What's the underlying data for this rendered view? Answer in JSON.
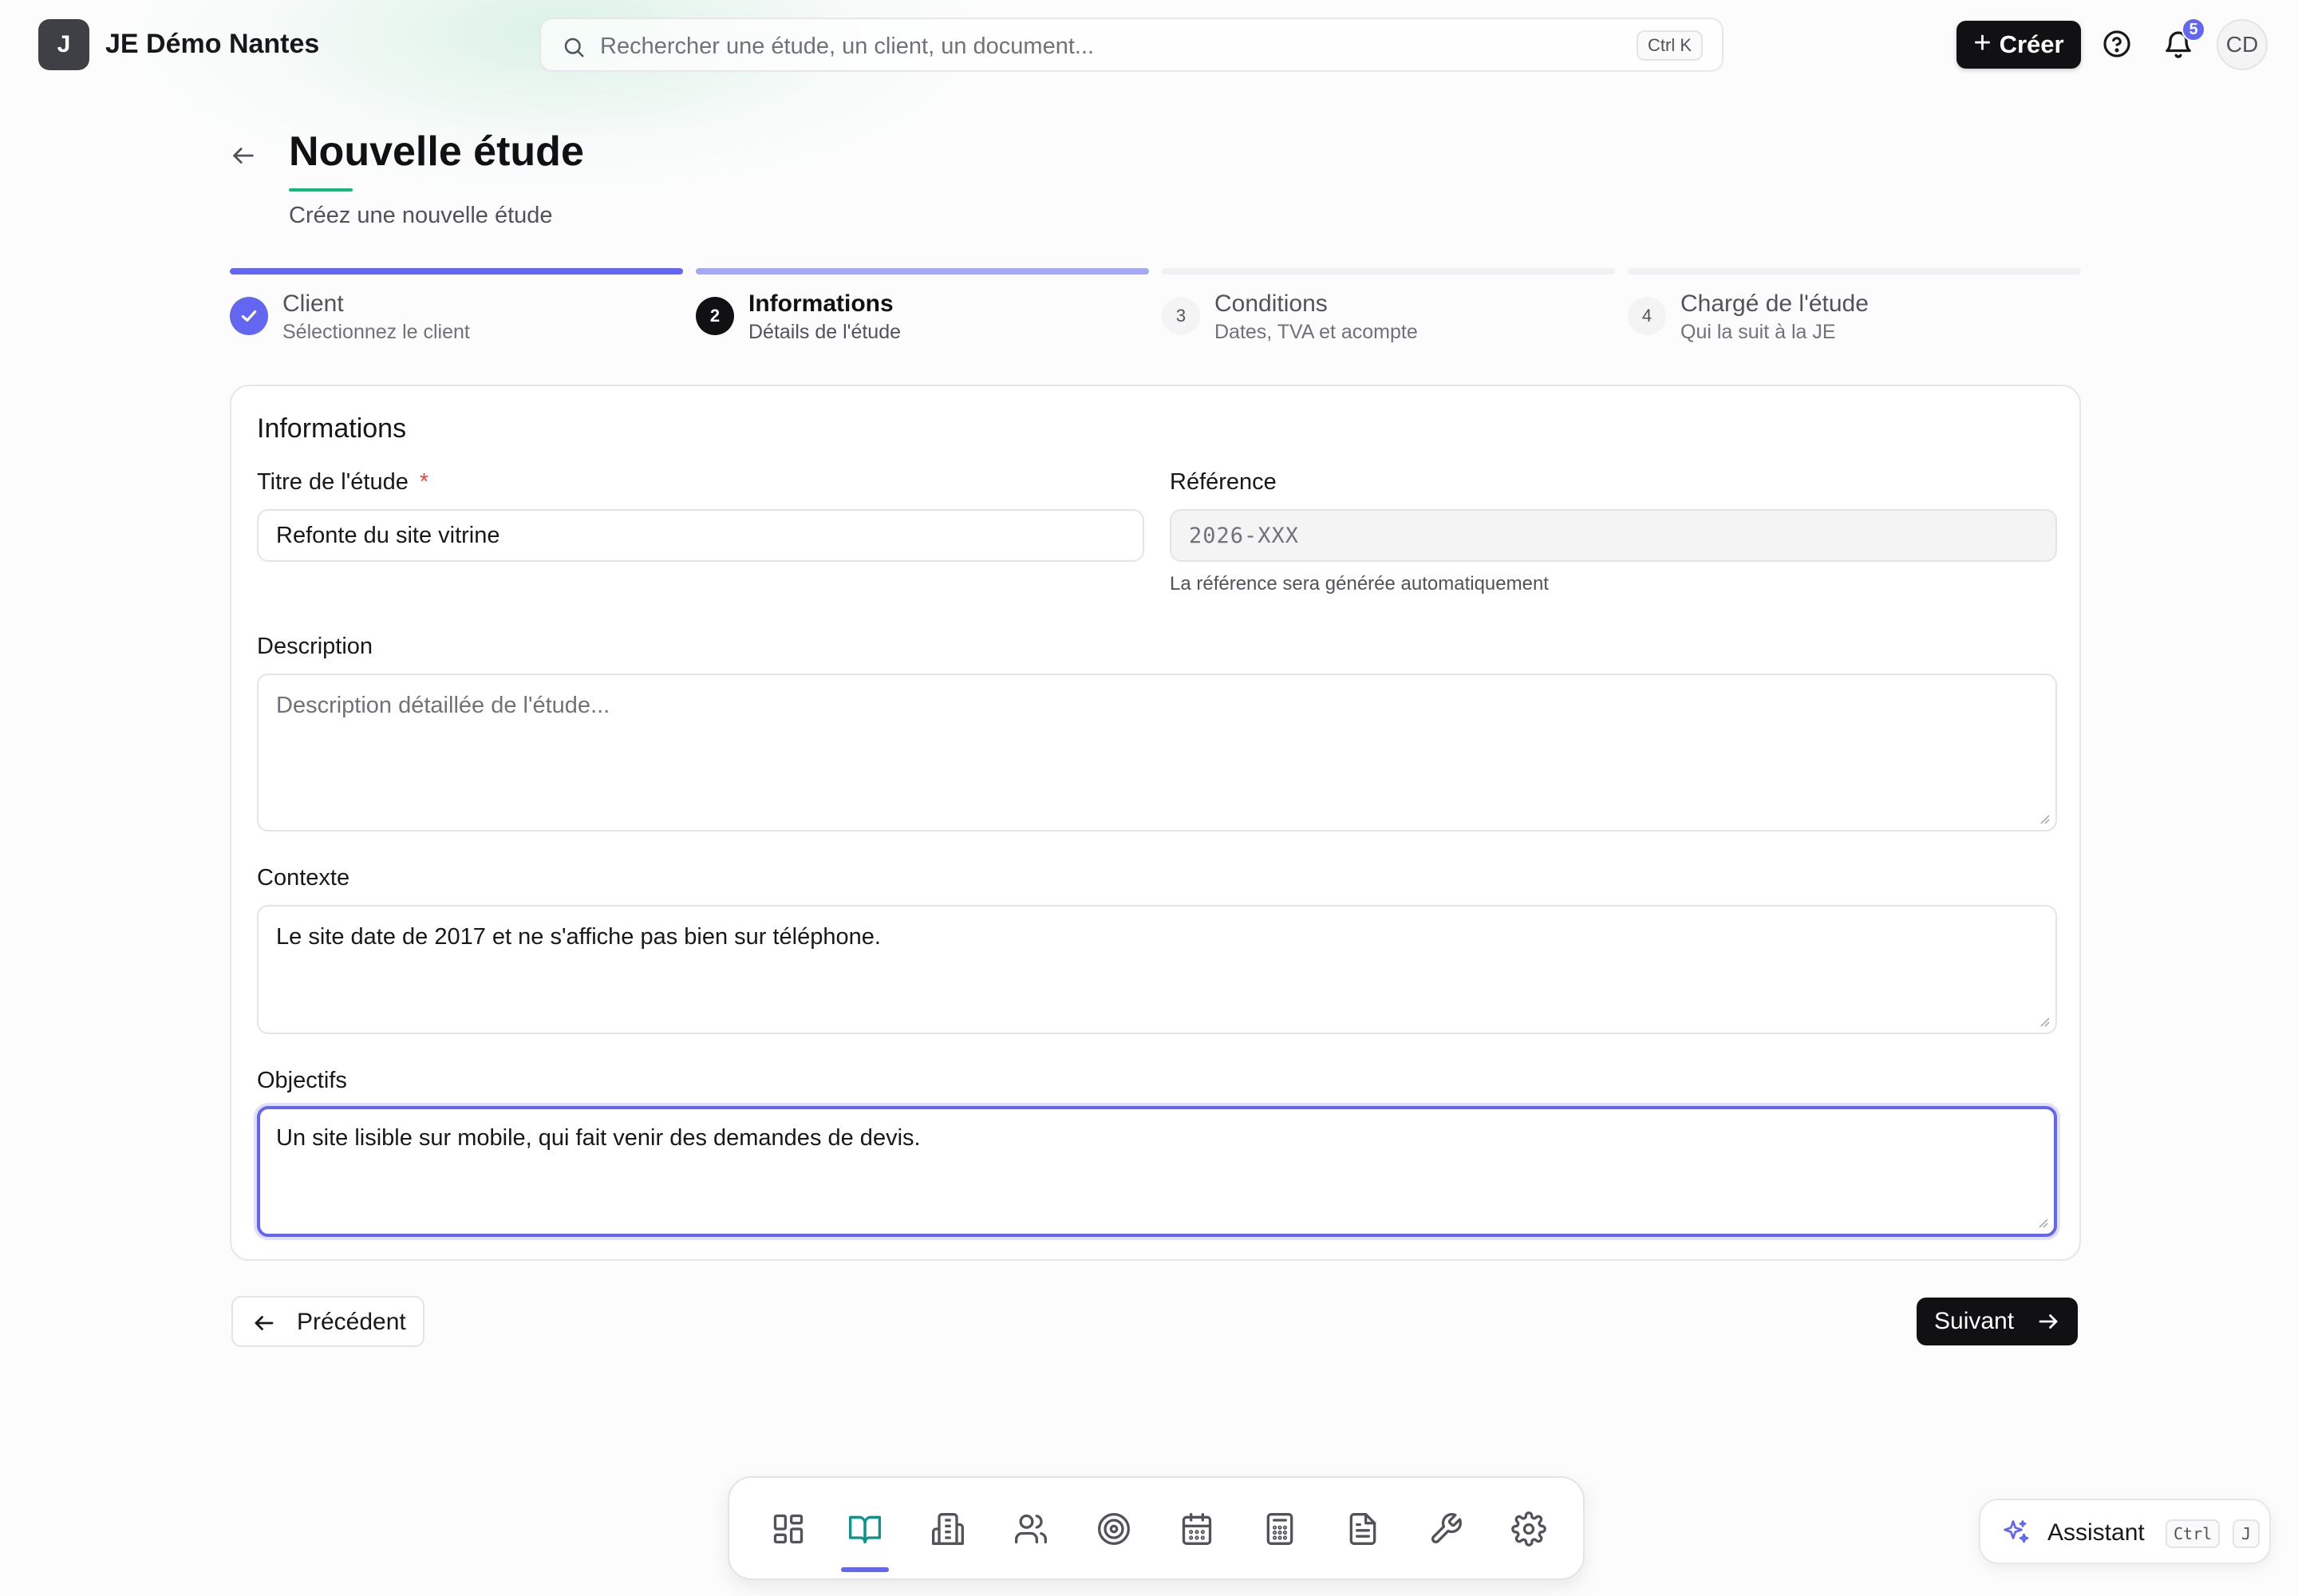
{
  "header": {
    "logo_letter": "J",
    "org_name": "JE Démo Nantes",
    "search_placeholder": "Rechercher une étude, un client, un document...",
    "search_shortcut": "Ctrl K",
    "create_label": "Créer",
    "notification_count": "5",
    "avatar_initials": "CD"
  },
  "page": {
    "title": "Nouvelle étude",
    "subtitle": "Créez une nouvelle étude"
  },
  "stepper": {
    "steps": [
      {
        "number": "1",
        "title": "Client",
        "description": "Sélectionnez le client",
        "state": "completed"
      },
      {
        "number": "2",
        "title": "Informations",
        "description": "Détails de l'étude",
        "state": "current"
      },
      {
        "number": "3",
        "title": "Conditions",
        "description": "Dates, TVA et acompte",
        "state": "upcoming"
      },
      {
        "number": "4",
        "title": "Chargé de l'étude",
        "description": "Qui la suit à la JE",
        "state": "upcoming"
      }
    ]
  },
  "form": {
    "section_title": "Informations",
    "titre": {
      "label": "Titre de l'étude",
      "required_mark": "*",
      "value": "Refonte du site vitrine"
    },
    "reference": {
      "label": "Référence",
      "placeholder": "2026-XXX",
      "hint": "La référence sera générée automatiquement"
    },
    "description": {
      "label": "Description",
      "value": "",
      "placeholder": "Description détaillée de l'étude..."
    },
    "contexte": {
      "label": "Contexte",
      "value": "Le site date de 2017 et ne s'affiche pas bien sur téléphone."
    },
    "objectifs": {
      "label": "Objectifs",
      "value": "Un site lisible sur mobile, qui fait venir des demandes de devis."
    }
  },
  "actions": {
    "previous_label": "Précédent",
    "next_label": "Suivant"
  },
  "dock": {
    "items": [
      {
        "icon": "dashboard-grid-icon"
      },
      {
        "icon": "open-book-icon",
        "active": true
      },
      {
        "icon": "building-icon"
      },
      {
        "icon": "users-icon"
      },
      {
        "icon": "target-icon"
      },
      {
        "icon": "calendar-icon"
      },
      {
        "icon": "calculator-icon"
      },
      {
        "icon": "document-icon"
      },
      {
        "icon": "wrench-icon"
      },
      {
        "icon": "gear-icon"
      }
    ]
  },
  "assistant": {
    "label": "Assistant",
    "shortcut_mod": "Ctrl",
    "shortcut_key": "J"
  },
  "colors": {
    "accent": "#6366f1",
    "accent_light": "#a5a8f4",
    "title_underline": "#10b981",
    "dock_active_icon": "#0d9488",
    "primary_button": "#111114"
  }
}
